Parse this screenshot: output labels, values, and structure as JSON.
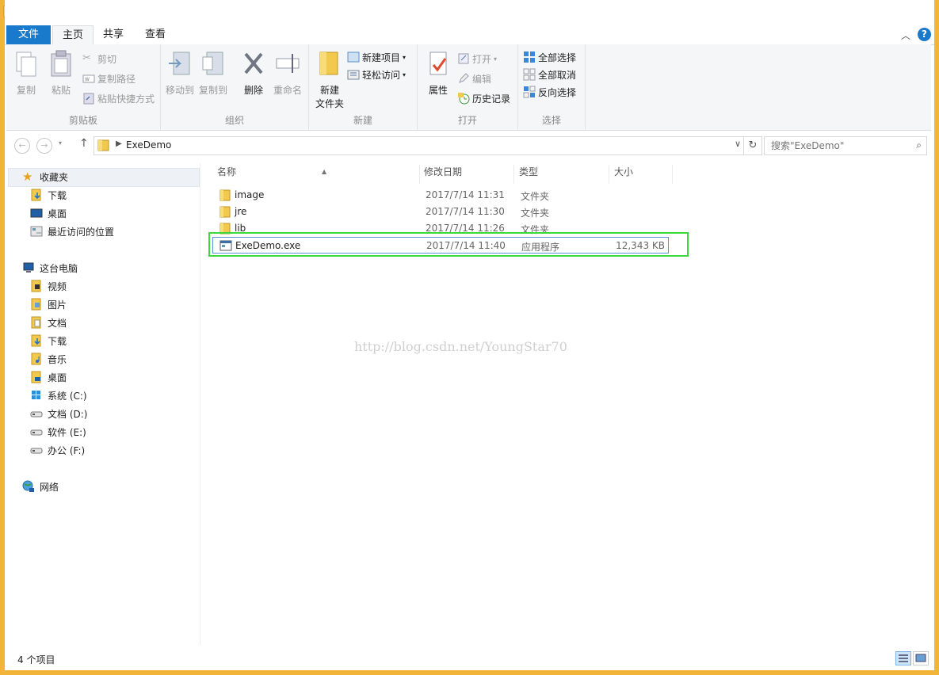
{
  "window": {
    "title": "ExeDemo"
  },
  "window_controls": {
    "minimize": "—",
    "maximize": "☐",
    "close": "✕"
  },
  "tabs": {
    "file": "文件",
    "home": "主页",
    "share": "共享",
    "view": "查看"
  },
  "ribbon": {
    "clipboard": {
      "label": "剪贴板",
      "copy": "复制",
      "paste": "粘贴",
      "cut": "剪切",
      "copy_path": "复制路径",
      "paste_shortcut": "粘贴快捷方式"
    },
    "organize": {
      "label": "组织",
      "move_to": "移动到",
      "copy_to": "复制到",
      "delete": "删除",
      "rename": "重命名"
    },
    "new": {
      "label": "新建",
      "new_folder": "新建\n文件夹",
      "new_item": "新建项目",
      "easy_access": "轻松访问"
    },
    "open": {
      "label": "打开",
      "properties": "属性",
      "open": "打开",
      "edit": "编辑",
      "history": "历史记录"
    },
    "select": {
      "label": "选择",
      "select_all": "全部选择",
      "select_none": "全部取消",
      "invert": "反向选择"
    }
  },
  "address": {
    "path": "ExeDemo"
  },
  "search": {
    "placeholder": "搜索\"ExeDemo\""
  },
  "nav": {
    "favorites": "收藏夹",
    "fav_items": [
      "下载",
      "桌面",
      "最近访问的位置"
    ],
    "this_pc": "这台电脑",
    "pc_items": [
      "视频",
      "图片",
      "文档",
      "下载",
      "音乐",
      "桌面",
      "系统 (C:)",
      "文档 (D:)",
      "软件 (E:)",
      "办公 (F:)"
    ],
    "network": "网络"
  },
  "columns": {
    "name": "名称",
    "date": "修改日期",
    "type": "类型",
    "size": "大小"
  },
  "files": [
    {
      "name": "image",
      "date": "2017/7/14 11:31",
      "type": "文件夹",
      "size": ""
    },
    {
      "name": "jre",
      "date": "2017/7/14 11:30",
      "type": "文件夹",
      "size": ""
    },
    {
      "name": "lib",
      "date": "2017/7/14 11:26",
      "type": "文件夹",
      "size": ""
    },
    {
      "name": "ExeDemo.exe",
      "date": "2017/7/14 11:40",
      "type": "应用程序",
      "size": "12,343 KB"
    }
  ],
  "watermark": "http://blog.csdn.net/YoungStar70",
  "status": {
    "count": "4 个项目"
  },
  "colors": {
    "accent": "#1979ca",
    "titlebar": "#f2b53a",
    "highlight": "#3bd93b"
  }
}
